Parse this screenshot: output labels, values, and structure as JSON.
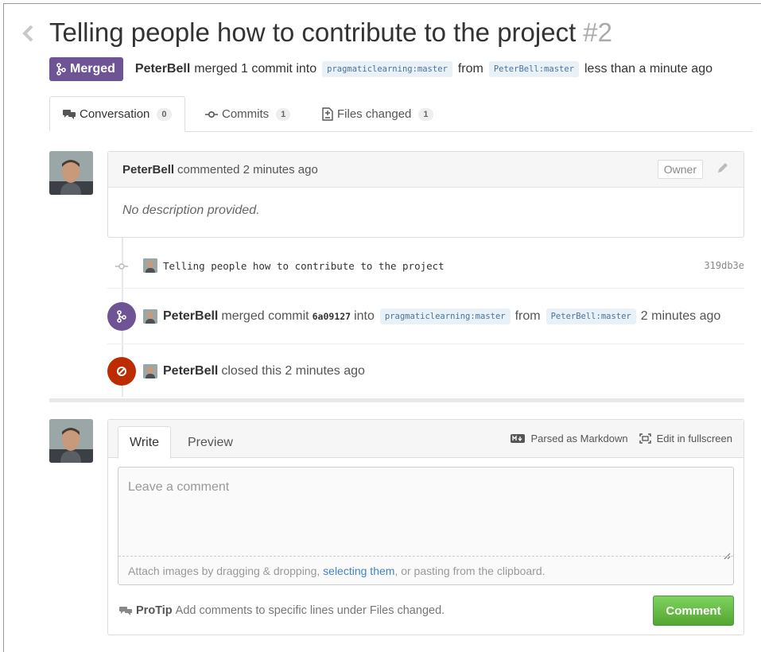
{
  "pr": {
    "title": "Telling people how to contribute to the project",
    "number": "#2",
    "state_label": "Merged",
    "author": "PeterBell",
    "summary_merged": "merged 1 commit into",
    "base_branch": "pragmaticlearning:master",
    "from_word": "from",
    "head_branch": "PeterBell:master",
    "time_ago": "less than a minute ago"
  },
  "tabs": [
    {
      "label": "Conversation",
      "count": "0"
    },
    {
      "label": "Commits",
      "count": "1"
    },
    {
      "label": "Files changed",
      "count": "1"
    }
  ],
  "comment": {
    "author": "PeterBell",
    "action": "commented 2 minutes ago",
    "role_badge": "Owner",
    "body": "No description provided."
  },
  "timeline": {
    "commit_message": "Telling people how to contribute to the project",
    "commit_sha": "319db3e",
    "merge_author": "PeterBell",
    "merge_action": "merged commit",
    "merge_sha": "6a09127",
    "merge_into": "into",
    "merge_base": "pragmaticlearning:master",
    "merge_from": "from",
    "merge_head": "PeterBell:master",
    "merge_time": "2 minutes ago",
    "close_author": "PeterBell",
    "close_action": "closed this 2 minutes ago"
  },
  "form": {
    "write_tab": "Write",
    "preview_tab": "Preview",
    "markdown_label": "Parsed as Markdown",
    "fullscreen_label": "Edit in fullscreen",
    "placeholder": "Leave a comment",
    "attach_prefix": "Attach images by dragging & dropping,",
    "attach_link": "selecting them",
    "attach_suffix": ", or pasting from the clipboard.",
    "protip_label": "ProTip",
    "protip_text": "Add comments to specific lines under Files changed.",
    "submit_label": "Comment"
  },
  "colors": {
    "merged_purple": "#6e5494",
    "closed_red": "#bd2c00",
    "comment_green": "#55a532",
    "link_blue": "#4183c4"
  }
}
